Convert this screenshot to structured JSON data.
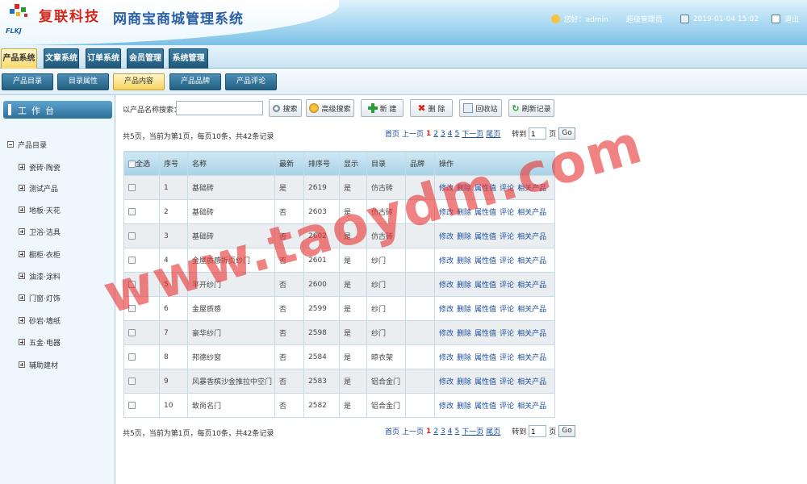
{
  "header": {
    "logo_text": "复联科技",
    "logo_sub": "FLKJ",
    "title": "网商宝商城管理系统",
    "greeting": "您好：admin",
    "role": "超级管理员",
    "date": "2019-01-04 15:02",
    "logout": "退出"
  },
  "nav": {
    "tabs": [
      "产品系统",
      "文章系统",
      "订单系统",
      "会员管理",
      "系统管理"
    ],
    "active": 0
  },
  "subnav": {
    "tabs": [
      "产品目录",
      "目录属性",
      "产品内容",
      "产品品牌",
      "产品评论"
    ],
    "active": 2
  },
  "sidebar": {
    "title": "工作台",
    "root": "产品目录",
    "items": [
      "瓷砖·陶瓷",
      "测试产品",
      "地板·天花",
      "卫浴·洁具",
      "橱柜·衣柜",
      "油漆·涂料",
      "门窗·灯饰",
      "砂岩·墙纸",
      "五金·电器",
      "辅助建材"
    ]
  },
  "toolbar": {
    "search_label": "以产品名称搜索：",
    "search_value": "",
    "search_btn": "搜索",
    "advanced_btn": "高级搜索",
    "new_btn": "新 建",
    "delete_btn": "删 除",
    "recycle_btn": "回收站",
    "refresh_btn": "刷新记录"
  },
  "paging": {
    "info": "共5页，当前为第1页，每页10条，共42条记录",
    "first": "首页",
    "prev": "上一页",
    "pages": [
      "1",
      "2",
      "3",
      "4",
      "5"
    ],
    "current": "1",
    "next": "下一页",
    "last": "尾页",
    "goto": "转到",
    "page_input": "1",
    "page_unit": "页",
    "go": "Go"
  },
  "table": {
    "headers": [
      "全选",
      "序号",
      "名称",
      "最新",
      "排序号",
      "显示",
      "目录",
      "品牌",
      "操作"
    ],
    "ops": [
      "修改",
      "删除",
      "属性值",
      "评论",
      "相关产品"
    ],
    "rows": [
      {
        "no": "1",
        "name": "基础砖",
        "latest": "是",
        "sort": "2619",
        "show": "是",
        "cat": "仿古砖",
        "brand": ""
      },
      {
        "no": "2",
        "name": "基础砖",
        "latest": "否",
        "sort": "2603",
        "show": "是",
        "cat": "仿古砖",
        "brand": ""
      },
      {
        "no": "3",
        "name": "基础砖",
        "latest": "否",
        "sort": "2602",
        "show": "是",
        "cat": "仿古砖",
        "brand": ""
      },
      {
        "no": "4",
        "name": "金屋质感折页纱门",
        "latest": "否",
        "sort": "2601",
        "show": "是",
        "cat": "纱门",
        "brand": ""
      },
      {
        "no": "5",
        "name": "平开纱门",
        "latest": "否",
        "sort": "2600",
        "show": "是",
        "cat": "纱门",
        "brand": ""
      },
      {
        "no": "6",
        "name": "金屋质感",
        "latest": "否",
        "sort": "2599",
        "show": "是",
        "cat": "纱门",
        "brand": ""
      },
      {
        "no": "7",
        "name": "豪华纱门",
        "latest": "否",
        "sort": "2598",
        "show": "是",
        "cat": "纱门",
        "brand": ""
      },
      {
        "no": "8",
        "name": "邦德纱窗",
        "latest": "否",
        "sort": "2584",
        "show": "是",
        "cat": "晾衣架",
        "brand": ""
      },
      {
        "no": "9",
        "name": "风暴香槟沙金推拉中空门",
        "latest": "否",
        "sort": "2583",
        "show": "是",
        "cat": "铝合金门",
        "brand": ""
      },
      {
        "no": "10",
        "name": "致尚名门",
        "latest": "否",
        "sort": "2582",
        "show": "是",
        "cat": "铝合金门",
        "brand": ""
      }
    ]
  },
  "watermark": "www.taoydm.com",
  "colors": {
    "accent": "#2c6f99",
    "link": "#1a4d9c",
    "current_page": "#dd2222",
    "watermark": "#e83636"
  }
}
